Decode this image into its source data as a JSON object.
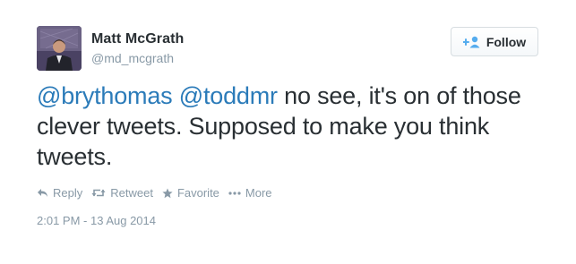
{
  "author": {
    "fullname": "Matt McGrath",
    "username": "@md_mcgrath",
    "avatar_icon": "profile-photo"
  },
  "follow_button": {
    "label": "Follow",
    "icon": "add-person-icon",
    "icon_color": "#55acee"
  },
  "tweet": {
    "mention_1": "@brythomas",
    "mention_2": "@toddmr",
    "body_text": " no see, it's on of those clever tweets. Supposed to make you think tweets.",
    "mention_color": "#2b7bb9"
  },
  "actions": {
    "reply_label": "Reply",
    "retweet_label": "Retweet",
    "favorite_label": "Favorite",
    "more_label": "More"
  },
  "timestamp": "2:01 PM - 13 Aug 2014"
}
